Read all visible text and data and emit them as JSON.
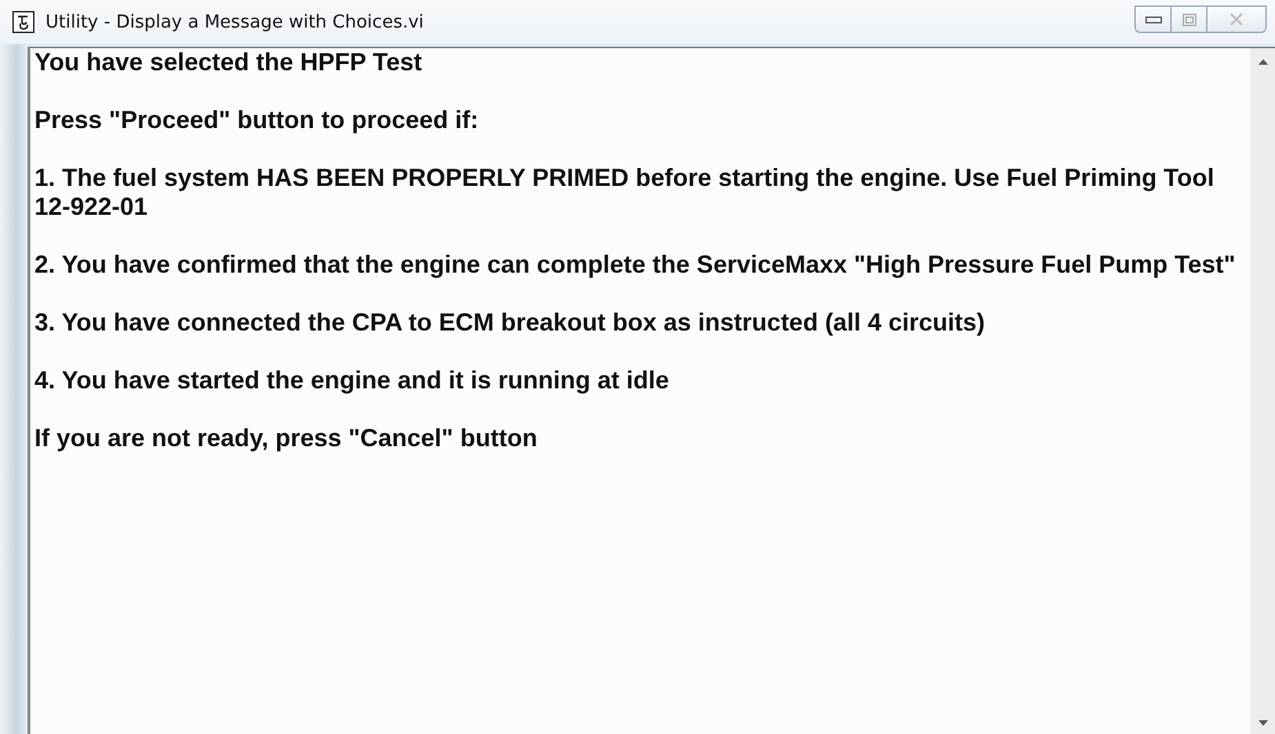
{
  "window": {
    "title": "Utility - Display a Message with Choices.vi"
  },
  "message": {
    "paragraphs": [
      "You have selected the HPFP Test",
      "Press \"Proceed\" button to proceed if:",
      "1. The fuel system HAS BEEN PROPERLY PRIMED before starting the engine. Use Fuel Priming Tool 12-922-01",
      "2. You have confirmed that the engine can complete the ServiceMaxx \"High Pressure Fuel Pump Test\"",
      "3. You have connected the CPA to ECM breakout box as instructed (all 4 circuits)",
      "4. You have started the engine and it is running at idle",
      "If you are not ready, press \"Cancel\" button"
    ]
  }
}
